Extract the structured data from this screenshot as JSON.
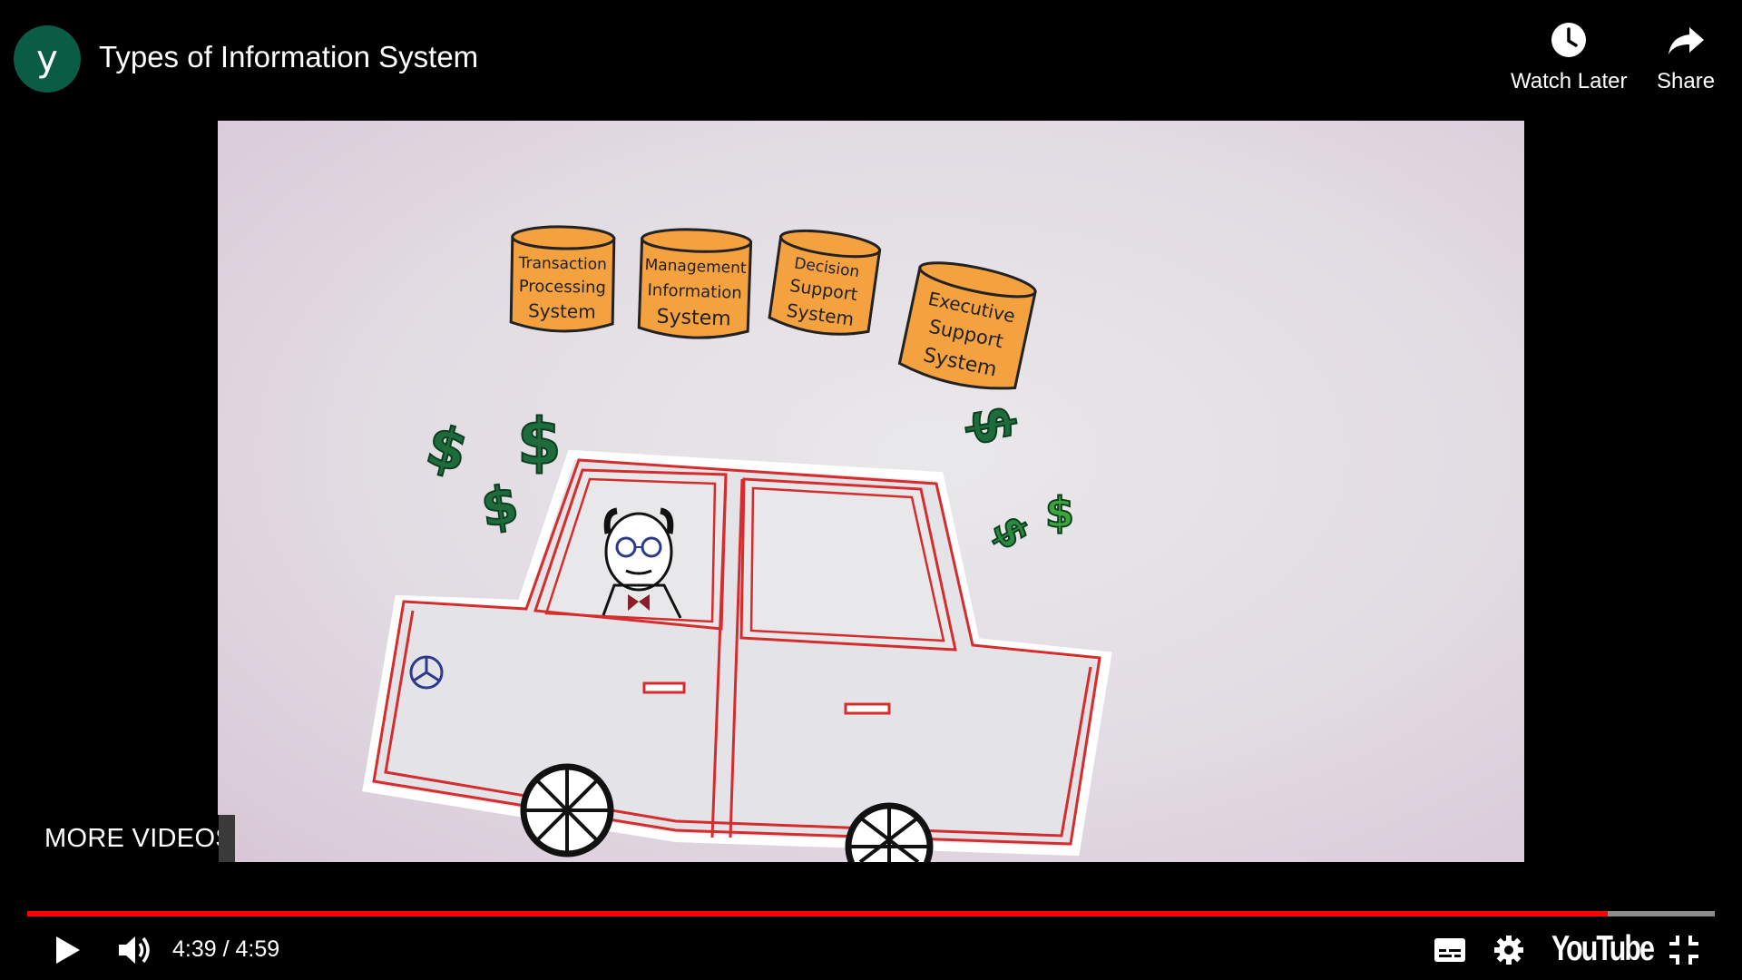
{
  "channel": {
    "avatar_letter": "y",
    "avatar_color": "#0a5c45"
  },
  "video": {
    "title": "Types of Information System",
    "scene_labels": {
      "tps": [
        "Transaction",
        "Processing",
        "System"
      ],
      "mis": [
        "Management",
        "Information",
        "System"
      ],
      "dss": [
        "Decision",
        "Support",
        "System"
      ],
      "ess": [
        "Executive",
        "Support",
        "System"
      ]
    },
    "dollar_sign": "$"
  },
  "top_actions": {
    "watch_later": "Watch Later",
    "share": "Share"
  },
  "more_videos": "MORE VIDEOS",
  "player": {
    "time_display": "4:39 / 4:59",
    "progress_fraction": 0.9365,
    "progress_color": "#ff0000",
    "logo_text": "YouTube"
  },
  "icons": {
    "watch_later": "clock-icon",
    "share": "share-arrow-icon",
    "play": "play-icon",
    "volume": "volume-icon",
    "captions": "captions-icon",
    "settings": "gear-icon",
    "fullscreen": "exit-fullscreen-icon"
  }
}
